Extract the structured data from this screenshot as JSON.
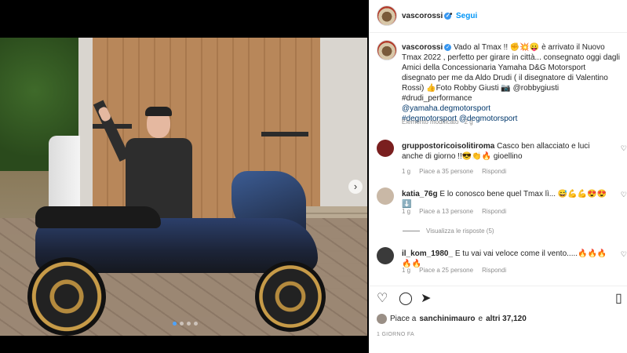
{
  "post_image": {
    "next_icon": "chevron-right-icon",
    "slide_count": 4,
    "active_slide": 1
  },
  "header": {
    "username": "vascorossi",
    "separator": "•",
    "follow_label": "Segui"
  },
  "caption": {
    "username": "vascorossi",
    "line1": "Vado al Tmax !! ✊💥😛 è arrivato il Nuovo Tmax 2022 , perfetto per girare in città... consegnato oggi dagli Amici della Concessionaria Yamaha D&G Motorsport disegnato per me da Aldo Drudi ( il disegnatore di Valentino Rossi) 👍Foto Robby Giusti 📷 @robbygiusti #drudi_performance",
    "tag1": "@yamaha.degmotorsport",
    "tag2": "#degmotorsport @degmotorsport",
    "edited": "Elemento modificato · 2 g"
  },
  "comments": [
    {
      "username": "gruppostoricoisolitiroma",
      "text": "Casco ben allacciato e luci anche di giorno !!😎👏🔥 gioellino",
      "age": "1 g",
      "likes": "Piace a 35 persone",
      "reply": "Rispondi",
      "avatar_color": "#7a1f1f"
    },
    {
      "username": "katia_76g",
      "text": "E lo conosco bene quel Tmax lì... 😅💪💪😍😍⬇️",
      "age": "1 g",
      "likes": "Piace a 13 persone",
      "reply": "Rispondi",
      "avatar_color": "#c9b8a6"
    },
    {
      "username": "il_kom_1980_",
      "text": "E tu vai vai veloce come il vento.....🔥🔥🔥🔥🔥",
      "age": "1 g",
      "likes": "Piace a 25 persone",
      "reply": "Rispondi",
      "avatar_color": "#3a3a3a"
    }
  ],
  "see_replies": "Visualizza le risposte (5)",
  "actions": {
    "like_icon": "heart-icon",
    "comment_icon": "comment-icon",
    "share_icon": "share-icon",
    "save_icon": "bookmark-icon"
  },
  "likes": {
    "prefix": "Piace a ",
    "user": "sanchinimauro",
    "middle": " e ",
    "others": "altri 37,120"
  },
  "time_ago": "1 GIORNO FA"
}
